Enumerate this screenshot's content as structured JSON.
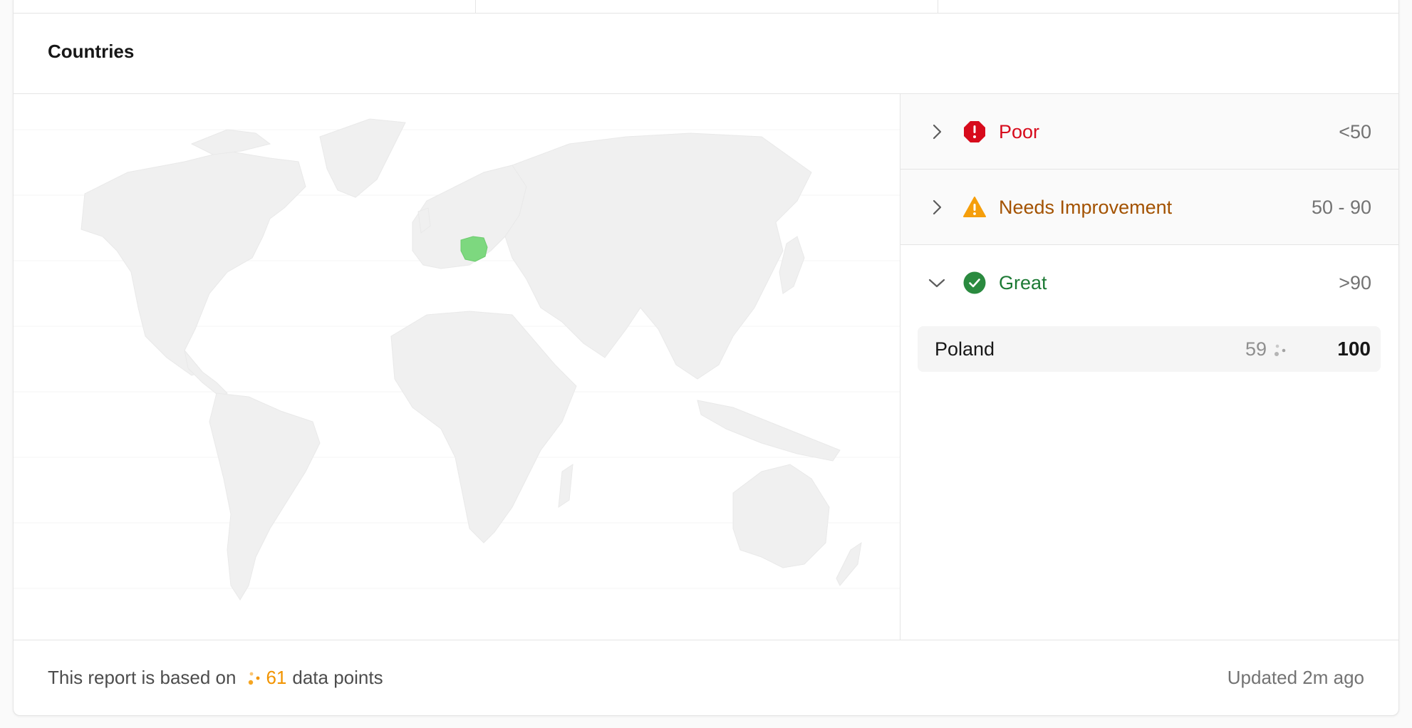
{
  "section": {
    "title": "Countries"
  },
  "categories": [
    {
      "label": "Poor",
      "range": "<50",
      "expanded": false,
      "icon": "error-octagon-icon",
      "color": "#d70b1c"
    },
    {
      "label": "Needs Improvement",
      "range": "50 - 90",
      "expanded": false,
      "icon": "warning-triangle-icon",
      "color": "#a35200"
    },
    {
      "label": "Great",
      "range": ">90",
      "expanded": true,
      "icon": "check-circle-icon",
      "color": "#1d7a35"
    }
  ],
  "countries": [
    {
      "name": "Poland",
      "data_points": "59",
      "score": "100",
      "highlight_color": "#7dd87f"
    }
  ],
  "footer": {
    "prefix": "This report is based on",
    "count": "61",
    "suffix": "data points",
    "updated": "Updated 2m ago"
  },
  "colors": {
    "land": "#f0f0f0",
    "border": "#e5e5e5",
    "accent_orange": "#f29400"
  }
}
